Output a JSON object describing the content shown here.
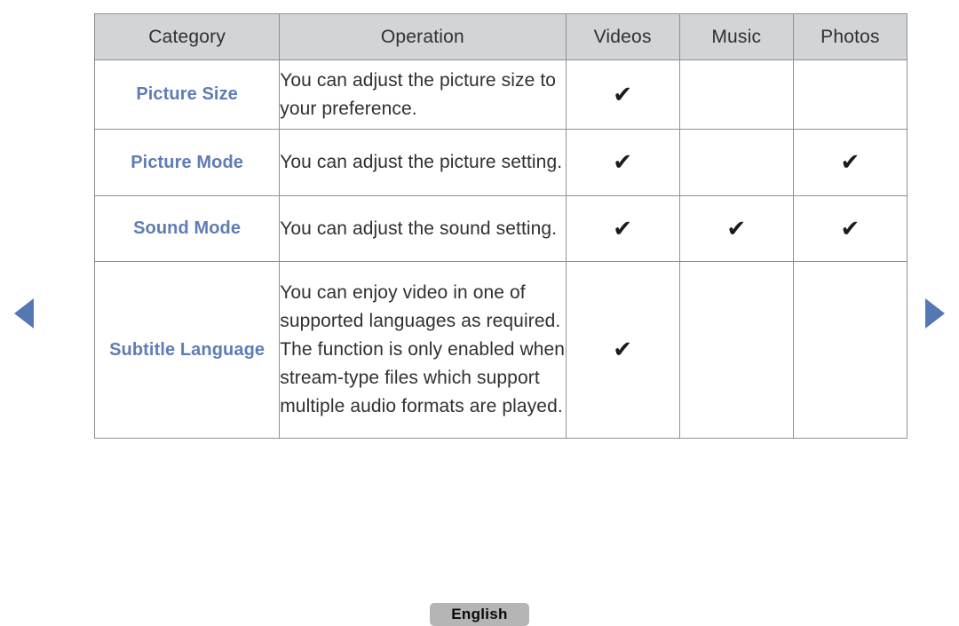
{
  "page": {
    "background_color": "#ffffff",
    "accent_color": "#5f7cb4",
    "header_background": "#d3d4d6",
    "border_color": "#8f9195"
  },
  "navigation": {
    "prev_label": "Previous page",
    "next_label": "Next page",
    "prev_icon": "triangle-left-icon",
    "next_icon": "triangle-right-icon"
  },
  "table": {
    "columns": [
      {
        "key": "category",
        "label": "Category"
      },
      {
        "key": "operation",
        "label": "Operation"
      },
      {
        "key": "videos",
        "label": "Videos"
      },
      {
        "key": "music",
        "label": "Music"
      },
      {
        "key": "photos",
        "label": "Photos"
      }
    ],
    "check_glyph": "✔",
    "rows": [
      {
        "category": "Picture Size",
        "operation": "You can adjust the picture size to your preference.",
        "videos": true,
        "music": false,
        "photos": false
      },
      {
        "category": "Picture Mode",
        "operation": "You can adjust the picture setting.",
        "videos": true,
        "music": false,
        "photos": true
      },
      {
        "category": "Sound Mode",
        "operation": "You can adjust the sound setting.",
        "videos": true,
        "music": true,
        "photos": true
      },
      {
        "category": "Subtitle Language",
        "operation": "You can enjoy video in one of supported languages as required. The function is only enabled when stream-type files which support multiple audio formats are played.",
        "videos": true,
        "music": false,
        "photos": false
      }
    ]
  },
  "footer": {
    "language_button_label": "English"
  }
}
